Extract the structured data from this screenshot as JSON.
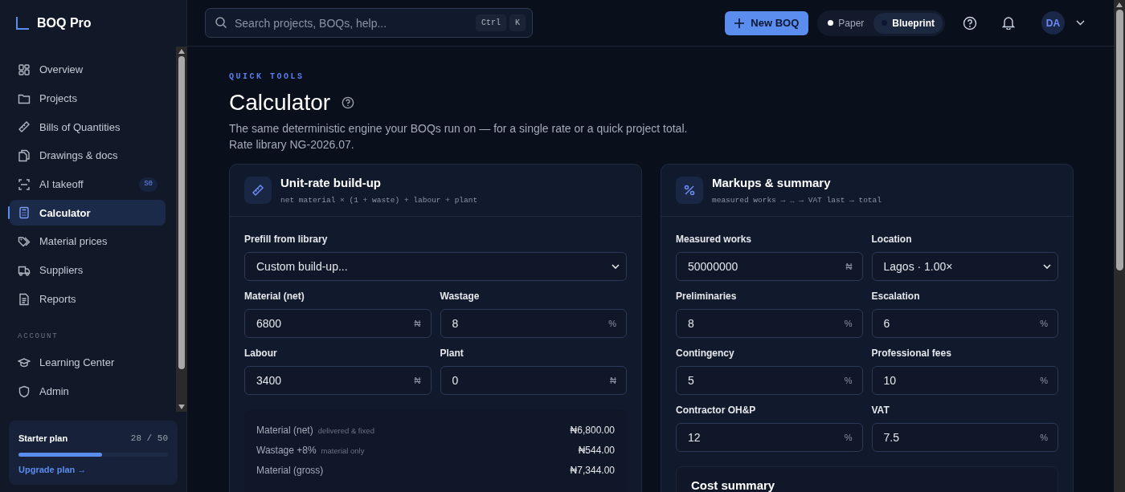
{
  "brand": {
    "name": "BOQ Pro"
  },
  "sidebar": {
    "items": [
      {
        "label": "Overview",
        "selected": false
      },
      {
        "label": "Projects",
        "selected": false
      },
      {
        "label": "Bills of Quantities",
        "selected": false
      },
      {
        "label": "Drawings & docs",
        "selected": false
      },
      {
        "label": "AI takeoff",
        "selected": false,
        "badge": "S0"
      },
      {
        "label": "Calculator",
        "selected": true
      },
      {
        "label": "Material prices",
        "selected": false
      },
      {
        "label": "Suppliers",
        "selected": false
      },
      {
        "label": "Reports",
        "selected": false
      }
    ],
    "section_label": "ACCOUNT",
    "account_items": [
      {
        "label": "Learning Center",
        "selected": false
      },
      {
        "label": "Admin",
        "selected": false
      }
    ],
    "plan": {
      "name": "Starter plan",
      "usage": "28 / 50",
      "level": 0.56,
      "link": "Upgrade plan →"
    }
  },
  "topbar": {
    "search": {
      "placeholder": "Search projects, BOQs, help...",
      "keys": [
        "Ctrl",
        "K"
      ]
    },
    "new_button": "New BOQ",
    "theme_toggle": [
      {
        "label": "Paper",
        "selected": false
      },
      {
        "label": "Blueprint",
        "selected": true
      }
    ],
    "avatar": "DA"
  },
  "page": {
    "eyebrow": "QUICK TOOLS",
    "title": "Calculator",
    "description": [
      "The same deterministic engine your BOQs run on — for a single rate or a quick project total.",
      "Rate library NG-2026.07."
    ]
  },
  "unit_rate_card": {
    "title": "Unit-rate build-up",
    "formula": "net material × (1 + waste) + labour + plant",
    "prefill": {
      "label": "Prefill from library",
      "value": "Custom build-up..."
    },
    "fields": [
      {
        "label": "Material (net)",
        "value": "6800",
        "unit": "₦"
      },
      {
        "label": "Wastage",
        "value": "8",
        "unit": "%"
      },
      {
        "label": "Labour",
        "value": "3400",
        "unit": "₦"
      },
      {
        "label": "Plant",
        "value": "0",
        "unit": "₦"
      }
    ],
    "breakdown": [
      {
        "label": "Material (net)",
        "note": "delivered & fixed",
        "amount": "₦6,800.00"
      },
      {
        "label": "Wastage +8%",
        "note": "material only",
        "amount": "₦544.00"
      },
      {
        "label": "Material (gross)",
        "amount": "₦7,344.00"
      }
    ]
  },
  "markups_card": {
    "title": "Markups & summary",
    "formula": "measured works → … → VAT last → total",
    "fields": [
      {
        "kind": "input",
        "label": "Measured works",
        "value": "50000000",
        "unit": "₦"
      },
      {
        "kind": "select",
        "label": "Location",
        "value": "Lagos · 1.00×"
      },
      {
        "kind": "input",
        "label": "Preliminaries",
        "value": "8",
        "unit": "%"
      },
      {
        "kind": "input",
        "label": "Escalation",
        "value": "6",
        "unit": "%"
      },
      {
        "kind": "input",
        "label": "Contingency",
        "value": "5",
        "unit": "%"
      },
      {
        "kind": "input",
        "label": "Professional fees",
        "value": "10",
        "unit": "%"
      },
      {
        "kind": "input",
        "label": "Contractor OH&P",
        "value": "12",
        "unit": "%"
      },
      {
        "kind": "input",
        "label": "VAT",
        "value": "7.5",
        "unit": "%"
      }
    ],
    "summary_title": "Cost summary"
  }
}
